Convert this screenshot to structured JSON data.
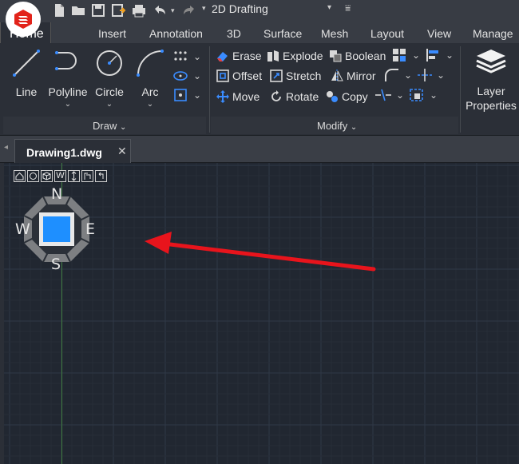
{
  "quick_access": {
    "workspace": "2D Drafting",
    "icons": [
      "new-file-icon",
      "open-folder-icon",
      "save-icon",
      "save-as-icon",
      "print-icon",
      "undo-icon",
      "redo-icon",
      "customize-icon"
    ]
  },
  "ribbon_tabs": [
    "Home",
    "Insert",
    "Annotation",
    "3D",
    "Surface",
    "Mesh",
    "Layout",
    "View",
    "Manage"
  ],
  "active_tab": "Home",
  "draw_panel": {
    "title": "Draw",
    "tools": [
      "Line",
      "Polyline",
      "Circle",
      "Arc"
    ]
  },
  "modify_panel": {
    "title": "Modify",
    "row1": [
      "Erase",
      "Explode",
      "Boolean"
    ],
    "row2": [
      "Offset",
      "Stretch",
      "Mirror"
    ],
    "row3": [
      "Move",
      "Rotate",
      "Copy"
    ]
  },
  "layer_panel": {
    "label_line1": "Layer",
    "label_line2": "Properties"
  },
  "document": {
    "tab_name": "Drawing1.dwg",
    "close_glyph": "✕"
  },
  "view_controls": {
    "labels": [
      "W"
    ],
    "compass": {
      "north": "N",
      "south": "S",
      "east": "E",
      "west": "W"
    }
  },
  "colors": {
    "accent_blue": "#1e8fff",
    "annotation_arrow": "#e8141c",
    "logo_red": "#e2231a"
  }
}
